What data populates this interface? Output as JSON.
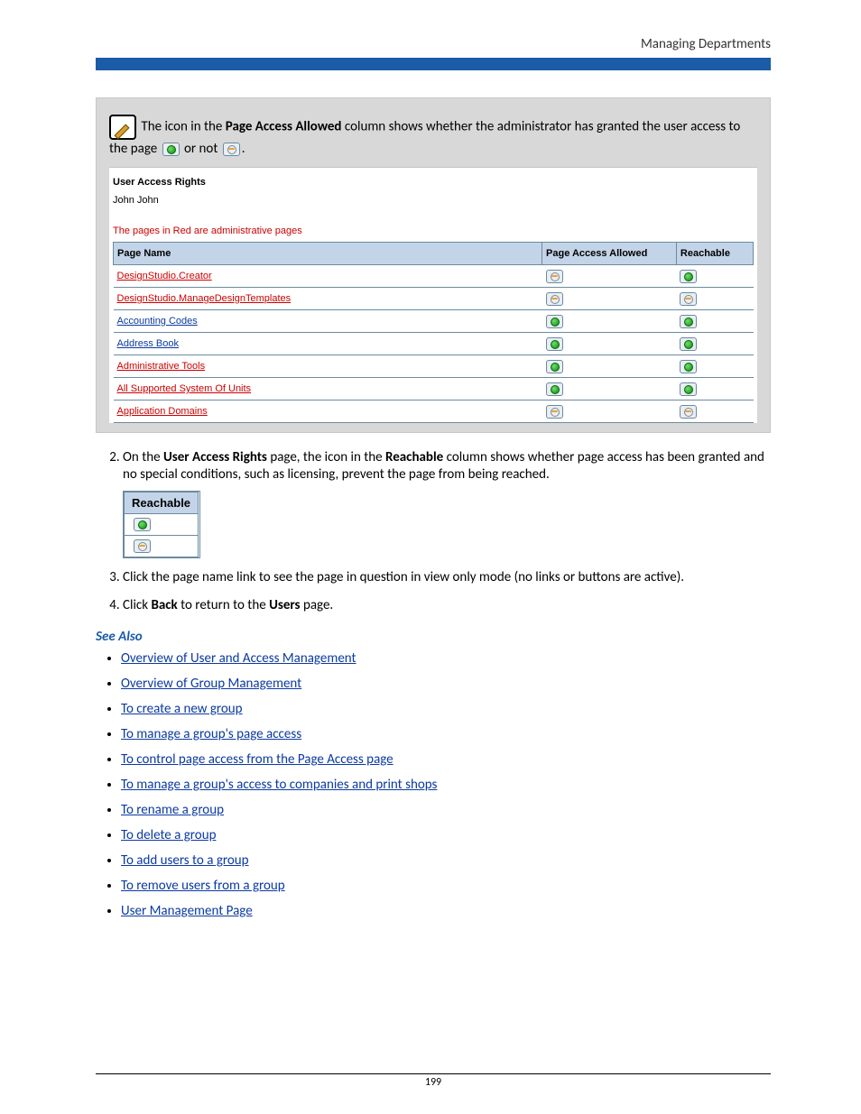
{
  "header": {
    "right": "Managing Departments"
  },
  "callout": {
    "pre": "The icon in the ",
    "bold1": "Page Access Allowed",
    "mid": " column shows whether the administrator has granted the user access to the page ",
    "or": " or not ",
    "end": "."
  },
  "shot": {
    "title": "User Access Rights",
    "subtitle": "John John",
    "note": "The pages in Red are administrative pages",
    "cols": {
      "c1": "Page Name",
      "c2": "Page Access Allowed",
      "c3": "Reachable"
    },
    "rows": [
      {
        "name": "DesignStudio.Creator",
        "link": "red",
        "access": "gray",
        "reach": "green"
      },
      {
        "name": "DesignStudio.ManageDesignTemplates",
        "link": "red",
        "access": "gray",
        "reach": "gray"
      },
      {
        "name": "Accounting Codes",
        "link": "blue",
        "access": "green",
        "reach": "green"
      },
      {
        "name": "Address Book",
        "link": "blue",
        "access": "green",
        "reach": "green"
      },
      {
        "name": "Administrative Tools",
        "link": "red",
        "access": "green",
        "reach": "green"
      },
      {
        "name": "All Supported System Of Units",
        "link": "red",
        "access": "green",
        "reach": "green"
      },
      {
        "name": "Application Domains",
        "link": "red",
        "access": "gray",
        "reach": "gray"
      }
    ]
  },
  "steps": {
    "s2a": "On the ",
    "s2b": "User Access Rights",
    "s2c": " page, the icon in the ",
    "s2d": "Reachable",
    "s2e": " column shows whether page access has been granted and no special conditions, such as licensing, prevent the page from being reached.",
    "reach_header": "Reachable",
    "s3": "Click the page name link to see the page in question in view only mode (no links or buttons are active).",
    "s4a": "Click ",
    "s4b": "Back",
    "s4c": " to return to the ",
    "s4d": "Users",
    "s4e": " page."
  },
  "see_also": {
    "title": "See Also",
    "links": [
      "Overview of User and Access Management",
      "Overview of Group Management",
      "To create a new group",
      "To manage a group's page access",
      "To control page access from the Page Access page",
      "To manage a group's access to companies and print shops",
      "To rename a group",
      "To delete a group",
      "To add users to a group",
      "To remove users from a group",
      "User Management Page"
    ]
  },
  "footer": {
    "page": "199"
  }
}
